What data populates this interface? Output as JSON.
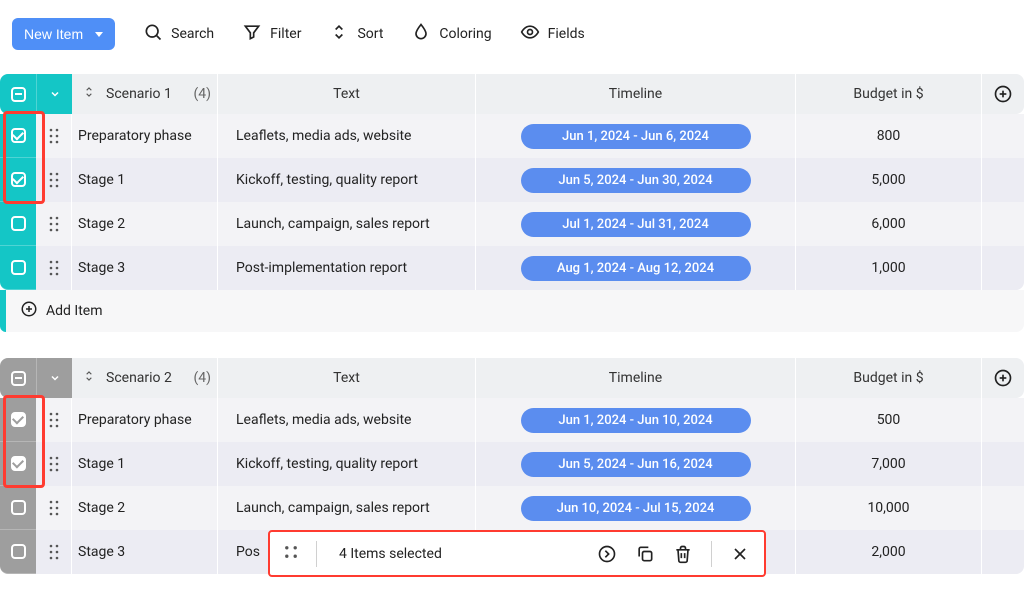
{
  "toolbar": {
    "new_item_label": "New Item",
    "search_label": "Search",
    "filter_label": "Filter",
    "sort_label": "Sort",
    "coloring_label": "Coloring",
    "fields_label": "Fields"
  },
  "columns": {
    "text": "Text",
    "timeline": "Timeline",
    "budget": "Budget in $"
  },
  "groups": [
    {
      "name": "Scenario 1",
      "count": "(4)",
      "muted": false,
      "add_item_label": "Add Item",
      "rows": [
        {
          "checked": true,
          "name": "Preparatory phase",
          "text": "Leaflets, media ads, website",
          "timeline": "Jun 1, 2024 - Jun 6, 2024",
          "budget": "800"
        },
        {
          "checked": true,
          "name": "Stage 1",
          "text": "Kickoff, testing, quality report",
          "timeline": "Jun 5, 2024 - Jun 30, 2024",
          "budget": "5,000"
        },
        {
          "checked": false,
          "name": "Stage 2",
          "text": "Launch, campaign, sales report",
          "timeline": "Jul 1, 2024 - Jul 31, 2024",
          "budget": "6,000"
        },
        {
          "checked": false,
          "name": "Stage 3",
          "text": "Post-implementation report",
          "timeline": "Aug 1, 2024 - Aug 12, 2024",
          "budget": "1,000"
        }
      ]
    },
    {
      "name": "Scenario 2",
      "count": "(4)",
      "muted": true,
      "rows": [
        {
          "checked": true,
          "name": "Preparatory phase",
          "text": "Leaflets, media ads, website",
          "timeline": "Jun 1, 2024 - Jun 10, 2024",
          "budget": "500"
        },
        {
          "checked": true,
          "name": "Stage 1",
          "text": "Kickoff, testing, quality report",
          "timeline": "Jun 5, 2024 - Jun 16, 2024",
          "budget": "7,000"
        },
        {
          "checked": false,
          "name": "Stage 2",
          "text": "Launch, campaign, sales report",
          "timeline": "Jun 10, 2024 - Jul 15, 2024",
          "budget": "10,000"
        },
        {
          "checked": false,
          "name": "Stage 3",
          "text": "Pos",
          "timeline": "",
          "budget": "2,000"
        }
      ]
    }
  ],
  "selection_toolbar": {
    "label": "4 Items selected"
  }
}
